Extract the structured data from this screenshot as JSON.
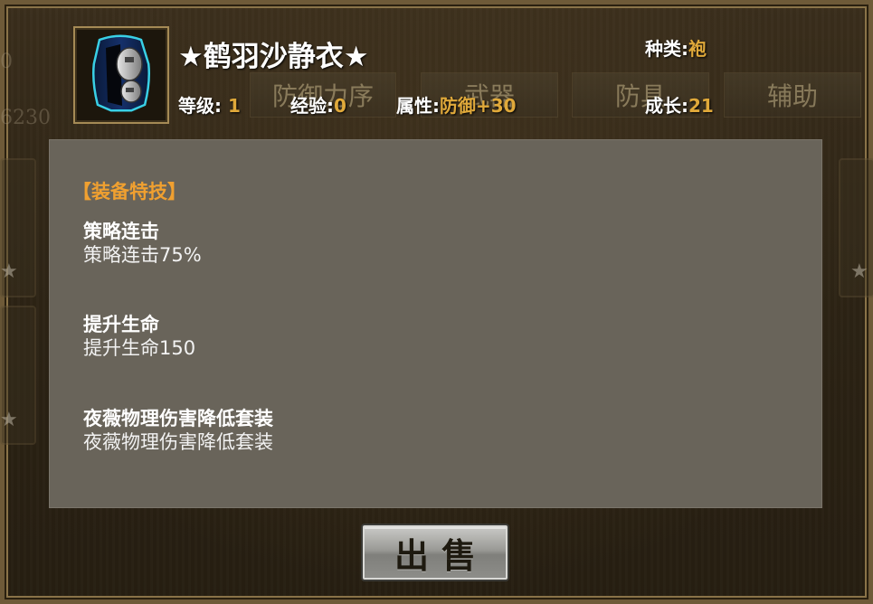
{
  "background": {
    "left_numbers": [
      "0",
      "6230"
    ],
    "tabs": [
      "防御力序",
      "武器",
      "防具",
      "辅助"
    ],
    "stars": [
      "★",
      "★",
      "★"
    ]
  },
  "item": {
    "icon": "armor-robe-icon",
    "name": "★鹤羽沙静衣★",
    "stats": {
      "type_label": "种类",
      "type_value": "袍",
      "level_label": "等级",
      "level_value": "1",
      "exp_label": "经验",
      "exp_value": "0",
      "attr_label": "属性",
      "attr_value": "防御+30",
      "growth_label": "成长",
      "growth_value": "21"
    }
  },
  "skills": {
    "header": "【装备特技】",
    "items": [
      {
        "name": "策略连击",
        "desc": "策略连击75%"
      },
      {
        "name": "提升生命",
        "desc": "提升生命150"
      },
      {
        "name": "夜薇物理伤害降低套装",
        "desc": "夜薇物理伤害降低套装"
      }
    ]
  },
  "actions": {
    "sell_label": "出售"
  },
  "colors": {
    "value_gold": "#e0a93a",
    "header_orange": "#f0a030",
    "panel_gray": "#69645a",
    "frame_brown": "#2c2314"
  }
}
